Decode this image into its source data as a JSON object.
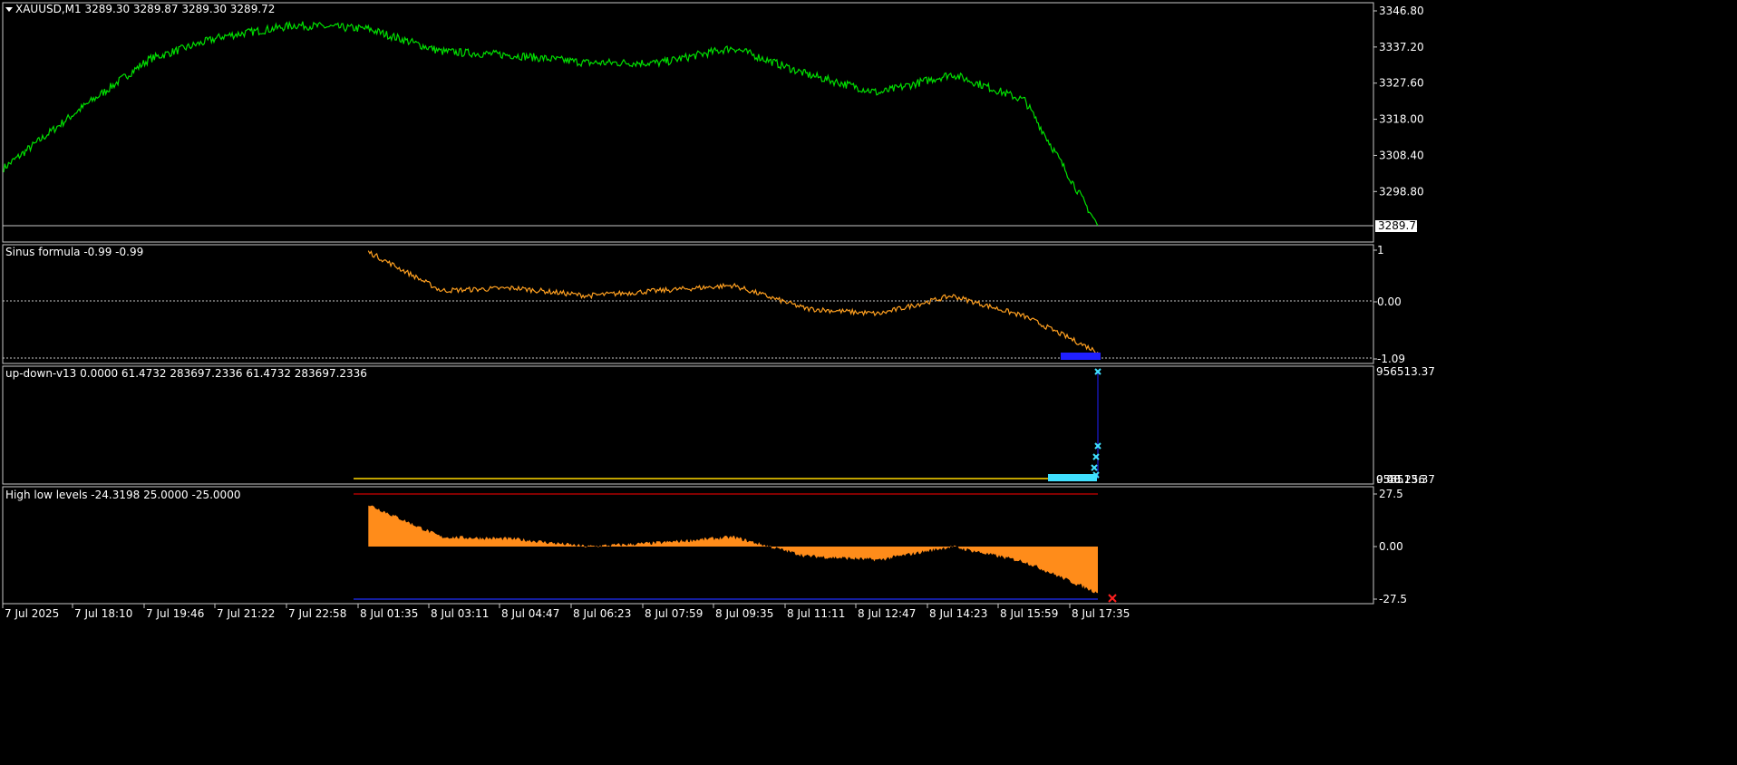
{
  "colors": {
    "background": "#000000",
    "frame": "#c8c8c8",
    "price_line": "#00e000",
    "sinus_line": "#ffa020",
    "updown_yellow": "#ffd700",
    "updown_cyan": "#40e0ff",
    "updown_blue": "#2020ff",
    "hl_fill": "#ff8c1a",
    "hl_upper": "#d00000",
    "hl_lower": "#2030ff",
    "marker_red": "#ff2020"
  },
  "panels": {
    "price": {
      "header": "XAUUSD,M1  3289.30 3289.87 3289.30 3289.72",
      "current_price": "3289.72",
      "ticks": [
        "3346.80",
        "3337.20",
        "3327.60",
        "3318.00",
        "3308.40",
        "3298.80"
      ]
    },
    "sinus": {
      "header": "Sinus formula -0.99 -0.99",
      "ticks": [
        "1",
        "0.00",
        "-1.09"
      ]
    },
    "updown": {
      "header": "up-down-v13 0.0000 61.4732 283697.2336 61.4732 283697.2336",
      "tick_top": "956513.37",
      "tick_bottom": "956513.37",
      "tick_overlap": "0.00",
      "tick_extra": "48.256"
    },
    "highlow": {
      "header": "High low levels -24.3198 25.0000 -25.0000",
      "ticks": [
        "27.5",
        "0.00",
        "-27.5"
      ]
    }
  },
  "time_axis": {
    "labels": [
      "7 Jul 2025",
      "7 Jul 18:10",
      "7 Jul 19:46",
      "7 Jul 21:22",
      "7 Jul 22:58",
      "8 Jul 01:35",
      "8 Jul 03:11",
      "8 Jul 04:47",
      "8 Jul 06:23",
      "8 Jul 07:59",
      "8 Jul 09:35",
      "8 Jul 11:11",
      "8 Jul 12:47",
      "8 Jul 14:23",
      "8 Jul 15:59",
      "8 Jul 17:35"
    ]
  },
  "chart_data": {
    "type": "line",
    "title": "XAUUSD,M1",
    "x": [
      "7 Jul 2025",
      "7 Jul 18:10",
      "7 Jul 19:46",
      "7 Jul 21:22",
      "7 Jul 22:58",
      "8 Jul 01:35",
      "8 Jul 03:11",
      "8 Jul 04:47",
      "8 Jul 06:23",
      "8 Jul 07:59",
      "8 Jul 09:35",
      "8 Jul 11:11",
      "8 Jul 12:47",
      "8 Jul 14:23",
      "8 Jul 15:59",
      "8 Jul 17:35"
    ],
    "series": [
      {
        "name": "XAUUSD,M1",
        "values": [
          3305,
          3320,
          3334,
          3340,
          3343,
          3342,
          3336,
          3335,
          3333,
          3333,
          3337,
          3330,
          3325,
          3330,
          3323,
          3289.72
        ]
      },
      {
        "name": "Sinus formula",
        "values": [
          null,
          null,
          null,
          null,
          null,
          0.95,
          0.2,
          0.25,
          0.1,
          0.2,
          0.3,
          -0.15,
          -0.25,
          0.1,
          -0.3,
          -0.99
        ]
      },
      {
        "name": "High low levels",
        "values": [
          null,
          null,
          null,
          null,
          null,
          22,
          5,
          4,
          0,
          2,
          5,
          -5,
          -7,
          0,
          -8,
          -24.3198
        ]
      }
    ],
    "ylim": [
      3289.72,
      3346.8
    ],
    "grid": false,
    "levels": {
      "upper": 25.0,
      "lower": -25.0
    }
  }
}
